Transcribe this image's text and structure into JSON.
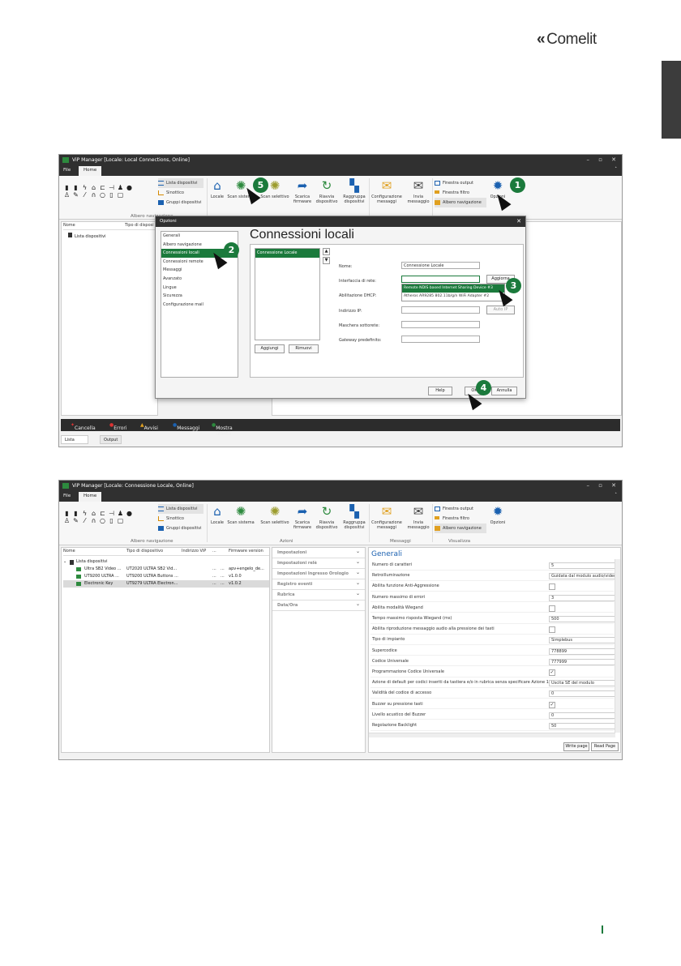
{
  "brand": {
    "logo_text": "Comelit",
    "accent": "#1b7a3c"
  },
  "shot1": {
    "title": "ViP Manager [Locale: Local Connections, Online]",
    "menu": [
      "File",
      "Home"
    ],
    "list_items": [
      "Lista dispositivi",
      "Sinottico",
      "Gruppi dispositivi"
    ],
    "ribbon_buttons": [
      {
        "label": "Locale",
        "icon": "home-icon"
      },
      {
        "label": "Scan sistema",
        "icon": "network-icon"
      },
      {
        "label": "Scan selettivo",
        "icon": "network-icon"
      },
      {
        "label": "Scarica firmware",
        "icon": "arrow-icon"
      },
      {
        "label": "Riavvia dispositivo",
        "icon": "refresh-icon"
      },
      {
        "label": "Raggruppa dispositivi",
        "icon": "group-icon"
      },
      {
        "label": "Configurazione messaggi",
        "icon": "mail-icon"
      },
      {
        "label": "Invia messaggio",
        "icon": "envelope-icon"
      }
    ],
    "view_items": [
      "Finestra output",
      "Finestra filtro",
      "Albero navigazione"
    ],
    "opzioni": "Opzioni",
    "group_albero": "Albero navigazione",
    "col_nome": "Nome",
    "col_tipo": "Tipo di disposi",
    "tree_root": "Lista dispositivi",
    "dialog": {
      "title": "Opzioni",
      "nav": [
        "Generali",
        "Albero navigazione",
        "Connessioni locali",
        "Connessioni remote",
        "Messaggi",
        "Avanzato",
        "Lingue",
        "Sicurezza",
        "Configurazione mail"
      ],
      "selected_index": 2,
      "heading": "Connessioni locali",
      "connection_item": "Connessione Locale",
      "add": "Aggiungi",
      "remove": "Rimuovi",
      "fields": {
        "nome_label": "Nome:",
        "nome_value": "Connessione Locale",
        "interfaccia_label": "Interfaccia di rete:",
        "dhcp_label": "Abilitazione DHCP:",
        "ip_label": "Indirizzo IP:",
        "mask_label": "Maschera sottorete:",
        "gw_label": "Gateway predefinito:"
      },
      "aggiorna": "Aggiorna",
      "auto_ip": "Auto IP",
      "dropdown": [
        "Remote NDIS based Internet Sharing Device #3",
        "Atheros AR9285 802.11b/g/n WiFi Adapter #2"
      ],
      "help": "Help",
      "ok": "OK",
      "annulla": "Annulla"
    },
    "msgbar": [
      "Cancella",
      "Errori",
      "Avvisi",
      "Messaggi",
      "Mostra ultimo"
    ],
    "bottom_tabs": [
      "Lista messaggi",
      "Output"
    ],
    "badges": [
      "1",
      "2",
      "3",
      "4",
      "5"
    ]
  },
  "shot2": {
    "title": "ViP Manager [Locale: Connessione Locale, Online]",
    "menu": [
      "File",
      "Home"
    ],
    "list_items": [
      "Lista dispositivi",
      "Sinottico",
      "Gruppi dispositivi"
    ],
    "groups": [
      "Albero navigazione",
      "Azioni",
      "Messaggi",
      "Visualizza"
    ],
    "opzioni": "Opzioni",
    "columns": [
      "Nome",
      "Tipo di dispositivo",
      "Indirizzo ViP",
      "...",
      "Firmware version"
    ],
    "tree_root": "Lista dispositivi",
    "devices": [
      {
        "name": "Ultra SB2 Video ...",
        "type": "UT2020 ULTRA SB2 Vid...",
        "d1": "...",
        "d2": "...",
        "fw": "apv+engelo_de..."
      },
      {
        "name": "UT9200 ULTRA ...",
        "type": "UT9200 ULTRA Buttons ...",
        "d1": "...",
        "d2": "...",
        "fw": "v1.0.0"
      },
      {
        "name": "Electronic Key",
        "type": "UT9279 ULTRA Electron...",
        "d1": "...",
        "d2": "...",
        "fw": "v1.0.2"
      }
    ],
    "accordion": [
      "Impostazioni",
      "Impostazioni relè",
      "Impostazioni Ingresso Orologio",
      "Registro eventi",
      "Rubrica",
      "Data/Ora"
    ],
    "section": "Generali",
    "properties": [
      {
        "k": "Numero di caratteri",
        "v": "5"
      },
      {
        "k": "Retroilluminazione",
        "v": "Guidata dal modulo audio/video"
      },
      {
        "k": "Abilita funzione Anti-Aggressione",
        "cb": ""
      },
      {
        "k": "Numero massimo di errori",
        "v": "3"
      },
      {
        "k": "Abilita modalità Wiegand",
        "cb": ""
      },
      {
        "k": "Tempo massimo risposta Wiegand (ms)",
        "v": "500"
      },
      {
        "k": "Abilita riproduzione messaggio audio alla pressione dei tasti",
        "cb": ""
      },
      {
        "k": "Tipo di impianto",
        "v": "Simplebus"
      },
      {
        "k": "Supercodice",
        "v": "778899"
      },
      {
        "k": "Codice Universale",
        "v": "777999"
      },
      {
        "k": "Programmazione Codice Universale",
        "cb": "✓"
      },
      {
        "k": "Azione di default per codici inseriti da tastiera e/o in rubrica senza specificare Azione 1",
        "v": "Uscita SE del modulo"
      },
      {
        "k": "Validità del codice di accesso",
        "v": "0"
      },
      {
        "k": "Buzzer su pressione tasti",
        "cb": "✓"
      },
      {
        "k": "Livello acustico del Buzzer",
        "v": "0"
      },
      {
        "k": "Regolazione Backlight",
        "v": "50"
      }
    ],
    "write_page": "Write page",
    "read_page": "Read Page"
  }
}
